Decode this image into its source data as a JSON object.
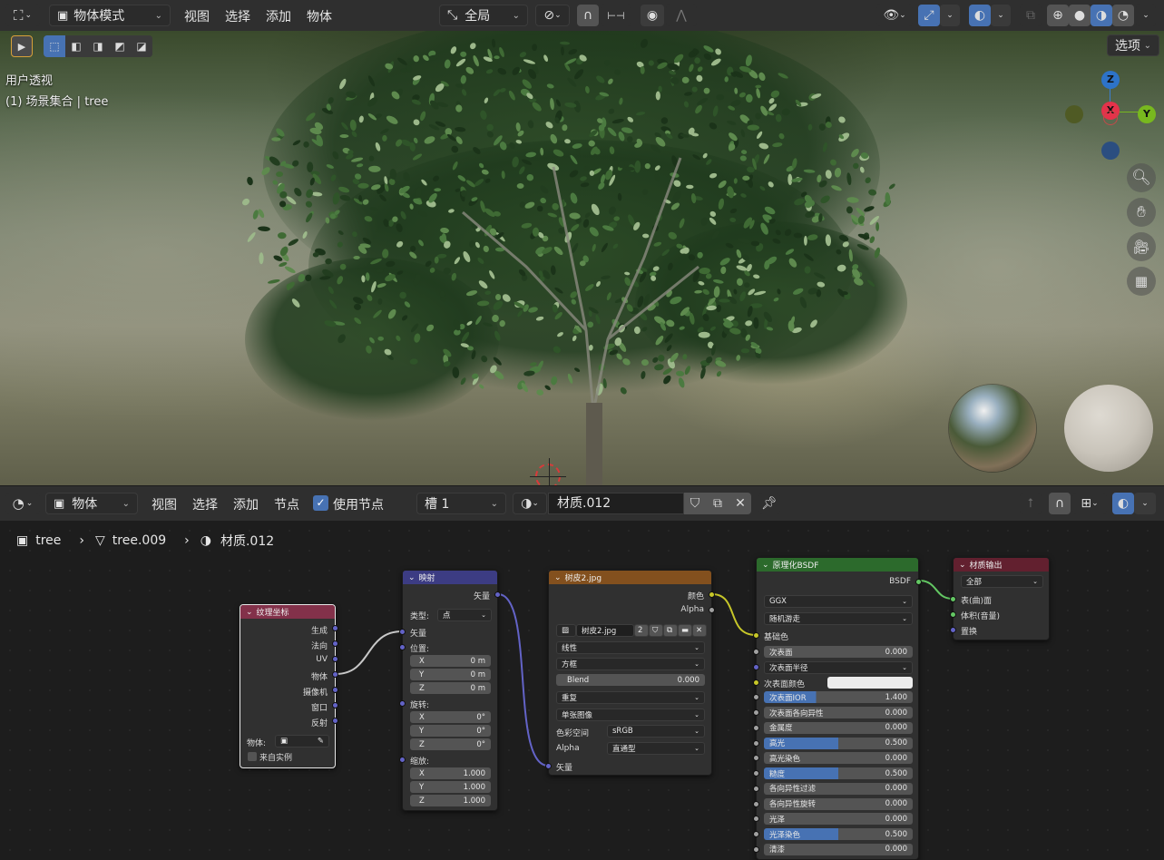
{
  "viewport_header": {
    "mode": "物体模式",
    "menus": [
      "视图",
      "选择",
      "添加",
      "物体"
    ],
    "transform_orientation": "全局",
    "options_label": "选项"
  },
  "viewport": {
    "view_name": "用户透视",
    "collection_info": "(1) 场景集合 | tree",
    "gizmo": {
      "z": "Z",
      "x": "X",
      "y": "Y"
    }
  },
  "node_header": {
    "object_type": "物体",
    "menus": [
      "视图",
      "选择",
      "添加",
      "节点"
    ],
    "use_nodes_label": "使用节点",
    "slot": "槽 1",
    "material_name": "材质.012"
  },
  "breadcrumb": {
    "object": "tree",
    "mesh": "tree.009",
    "material": "材质.012"
  },
  "nodes": {
    "texcoord": {
      "title": "纹理坐标",
      "outputs": [
        "生成",
        "法向",
        "UV",
        "物体",
        "摄像机",
        "窗口",
        "反射"
      ],
      "object_label": "物体:",
      "from_instancer": "来自实例"
    },
    "mapping": {
      "title": "映射",
      "output": "矢量",
      "type_label": "类型:",
      "type_value": "点",
      "vector_in": "矢量",
      "location_label": "位置:",
      "location": [
        {
          "axis": "X",
          "value": "0 m"
        },
        {
          "axis": "Y",
          "value": "0 m"
        },
        {
          "axis": "Z",
          "value": "0 m"
        }
      ],
      "rotation_label": "旋转:",
      "rotation": [
        {
          "axis": "X",
          "value": "0°"
        },
        {
          "axis": "Y",
          "value": "0°"
        },
        {
          "axis": "Z",
          "value": "0°"
        }
      ],
      "scale_label": "缩放:",
      "scale": [
        {
          "axis": "X",
          "value": "1.000"
        },
        {
          "axis": "Y",
          "value": "1.000"
        },
        {
          "axis": "Z",
          "value": "1.000"
        }
      ]
    },
    "image": {
      "title": "树皮2.jpg",
      "out_color": "颜色",
      "out_alpha": "Alpha",
      "image_name": "树皮2.jpg",
      "users": "2",
      "interpolation": "线性",
      "projection": "方框",
      "blend_label": "Blend",
      "blend_value": "0.000",
      "extension": "重复",
      "source": "单张图像",
      "colorspace_label": "色彩空间",
      "colorspace_value": "sRGB",
      "alpha_label": "Alpha",
      "alpha_value": "直通型",
      "vector_in": "矢量"
    },
    "bsdf": {
      "title": "原理化BSDF",
      "output": "BSDF",
      "distribution": "GGX",
      "subsurface_method": "随机游走",
      "base_color": "基础色",
      "fields": [
        {
          "label": "次表面",
          "value": "0.000",
          "fill": 0
        },
        {
          "label": "次表面半径",
          "value": "",
          "fill": 0,
          "dropdown": true
        },
        {
          "label": "次表面颜色",
          "value": "",
          "fill": 0,
          "color": true
        },
        {
          "label": "次表面IOR",
          "value": "1.400",
          "fill": 0.35
        },
        {
          "label": "次表面各向异性",
          "value": "0.000",
          "fill": 0
        },
        {
          "label": "金属度",
          "value": "0.000",
          "fill": 0
        },
        {
          "label": "高光",
          "value": "0.500",
          "fill": 0.5
        },
        {
          "label": "高光染色",
          "value": "0.000",
          "fill": 0
        },
        {
          "label": "糙度",
          "value": "0.500",
          "fill": 0.5
        },
        {
          "label": "各向异性过滤",
          "value": "0.000",
          "fill": 0
        },
        {
          "label": "各向异性旋转",
          "value": "0.000",
          "fill": 0
        },
        {
          "label": "光泽",
          "value": "0.000",
          "fill": 0
        },
        {
          "label": "光泽染色",
          "value": "0.500",
          "fill": 0.5
        },
        {
          "label": "清漆",
          "value": "0.000",
          "fill": 0
        }
      ]
    },
    "output": {
      "title": "材质输出",
      "target": "全部",
      "inputs": [
        "表(曲)面",
        "体积(音量)",
        "置换"
      ]
    }
  },
  "colors": {
    "header_bg": "#2f2f2f",
    "accent_blue": "#4772b3",
    "texcoord_header": "#83314a",
    "mapping_header": "#3c3c83",
    "image_header": "#83501e",
    "bsdf_header": "#2c6a2c",
    "output_header": "#62202f"
  }
}
